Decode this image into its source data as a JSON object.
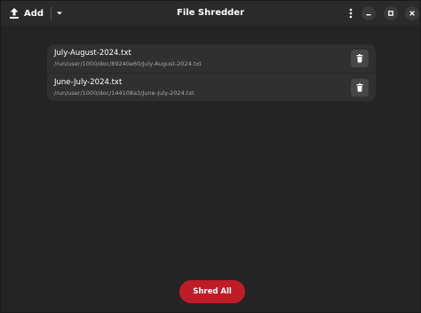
{
  "header": {
    "add_label": "Add",
    "title": "File Shredder",
    "icons": {
      "add": "upload-icon",
      "add_menu": "chevron-down-icon",
      "menu": "kebab-menu-icon",
      "minimize": "minimize-icon",
      "maximize": "maximize-icon",
      "close": "close-icon"
    }
  },
  "files": [
    {
      "name": "July-August-2024.txt",
      "path": "/run/user/1000/doc/89240e60/July-August-2024.txt"
    },
    {
      "name": "June-July-2024.txt",
      "path": "/run/user/1000/doc/144108a3/June-July-2024.txt"
    }
  ],
  "actions": {
    "shred_all_label": "Shred All",
    "delete_icon": "trash-icon"
  },
  "colors": {
    "window_bg": "#242424",
    "headerbar_bg": "#2a2a2a",
    "list_bg": "#303030",
    "accent_destructive": "#c01c28",
    "secondary_text": "#a8a8a8"
  }
}
